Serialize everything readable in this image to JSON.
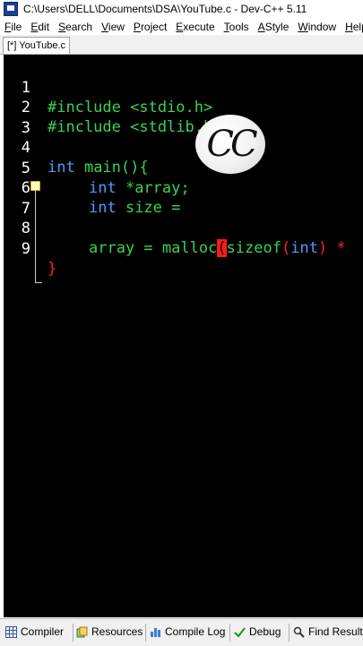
{
  "window": {
    "title": "C:\\Users\\DELL\\Documents\\DSA\\YouTube.c - Dev-C++ 5.11"
  },
  "menu": [
    {
      "u": "F",
      "rest": "ile"
    },
    {
      "u": "E",
      "rest": "dit"
    },
    {
      "u": "S",
      "rest": "earch"
    },
    {
      "u": "V",
      "rest": "iew"
    },
    {
      "u": "P",
      "rest": "roject"
    },
    {
      "u": "E",
      "rest": "xecute"
    },
    {
      "u": "T",
      "rest": "ools"
    },
    {
      "u": "A",
      "rest": "Style"
    },
    {
      "u": "W",
      "rest": "indow"
    },
    {
      "u": "H",
      "rest": "elp"
    }
  ],
  "editor": {
    "tab_label": "[*] YouTube.c",
    "line_numbers": [
      "1",
      "2",
      "3",
      "4",
      "5",
      "6",
      "7",
      "8",
      "9"
    ],
    "lines": {
      "l1": "#include <stdio.h>",
      "l2": "#include <stdlib.h>",
      "l4_kw": "int",
      "l4_rest": " main(){",
      "l5_kw": "int",
      "l5_rest": " *array;",
      "l6_kw": "int",
      "l6_rest": " size = ",
      "l8_a": "array = malloc",
      "l8_paren": "(",
      "l8_fn": "sizeof",
      "l8_b": "(",
      "l8_kw": "int",
      "l8_c": ") *",
      "l9": "}"
    },
    "overlay_logo_text": "CC"
  },
  "bottom_tabs": {
    "compiler": "Compiler",
    "resources": "Resources",
    "compile_log": "Compile Log",
    "debug": "Debug",
    "find_results": "Find Results"
  },
  "colors": {
    "editor_bg": "#000000",
    "keyword": "#4a9cff",
    "preprocessor": "#39d353",
    "bracket": "#ff2020"
  }
}
